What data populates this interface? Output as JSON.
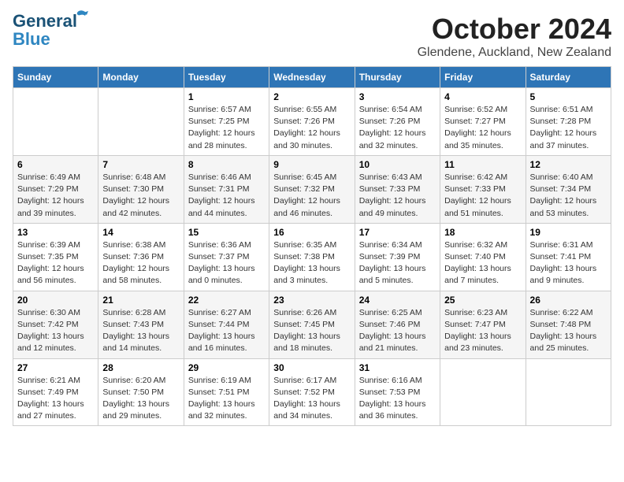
{
  "header": {
    "logo_general": "General",
    "logo_blue": "Blue",
    "month": "October 2024",
    "location": "Glendene, Auckland, New Zealand"
  },
  "weekdays": [
    "Sunday",
    "Monday",
    "Tuesday",
    "Wednesday",
    "Thursday",
    "Friday",
    "Saturday"
  ],
  "weeks": [
    [
      {
        "day": "",
        "info": ""
      },
      {
        "day": "",
        "info": ""
      },
      {
        "day": "1",
        "info": "Sunrise: 6:57 AM\nSunset: 7:25 PM\nDaylight: 12 hours\nand 28 minutes."
      },
      {
        "day": "2",
        "info": "Sunrise: 6:55 AM\nSunset: 7:26 PM\nDaylight: 12 hours\nand 30 minutes."
      },
      {
        "day": "3",
        "info": "Sunrise: 6:54 AM\nSunset: 7:26 PM\nDaylight: 12 hours\nand 32 minutes."
      },
      {
        "day": "4",
        "info": "Sunrise: 6:52 AM\nSunset: 7:27 PM\nDaylight: 12 hours\nand 35 minutes."
      },
      {
        "day": "5",
        "info": "Sunrise: 6:51 AM\nSunset: 7:28 PM\nDaylight: 12 hours\nand 37 minutes."
      }
    ],
    [
      {
        "day": "6",
        "info": "Sunrise: 6:49 AM\nSunset: 7:29 PM\nDaylight: 12 hours\nand 39 minutes."
      },
      {
        "day": "7",
        "info": "Sunrise: 6:48 AM\nSunset: 7:30 PM\nDaylight: 12 hours\nand 42 minutes."
      },
      {
        "day": "8",
        "info": "Sunrise: 6:46 AM\nSunset: 7:31 PM\nDaylight: 12 hours\nand 44 minutes."
      },
      {
        "day": "9",
        "info": "Sunrise: 6:45 AM\nSunset: 7:32 PM\nDaylight: 12 hours\nand 46 minutes."
      },
      {
        "day": "10",
        "info": "Sunrise: 6:43 AM\nSunset: 7:33 PM\nDaylight: 12 hours\nand 49 minutes."
      },
      {
        "day": "11",
        "info": "Sunrise: 6:42 AM\nSunset: 7:33 PM\nDaylight: 12 hours\nand 51 minutes."
      },
      {
        "day": "12",
        "info": "Sunrise: 6:40 AM\nSunset: 7:34 PM\nDaylight: 12 hours\nand 53 minutes."
      }
    ],
    [
      {
        "day": "13",
        "info": "Sunrise: 6:39 AM\nSunset: 7:35 PM\nDaylight: 12 hours\nand 56 minutes."
      },
      {
        "day": "14",
        "info": "Sunrise: 6:38 AM\nSunset: 7:36 PM\nDaylight: 12 hours\nand 58 minutes."
      },
      {
        "day": "15",
        "info": "Sunrise: 6:36 AM\nSunset: 7:37 PM\nDaylight: 13 hours\nand 0 minutes."
      },
      {
        "day": "16",
        "info": "Sunrise: 6:35 AM\nSunset: 7:38 PM\nDaylight: 13 hours\nand 3 minutes."
      },
      {
        "day": "17",
        "info": "Sunrise: 6:34 AM\nSunset: 7:39 PM\nDaylight: 13 hours\nand 5 minutes."
      },
      {
        "day": "18",
        "info": "Sunrise: 6:32 AM\nSunset: 7:40 PM\nDaylight: 13 hours\nand 7 minutes."
      },
      {
        "day": "19",
        "info": "Sunrise: 6:31 AM\nSunset: 7:41 PM\nDaylight: 13 hours\nand 9 minutes."
      }
    ],
    [
      {
        "day": "20",
        "info": "Sunrise: 6:30 AM\nSunset: 7:42 PM\nDaylight: 13 hours\nand 12 minutes."
      },
      {
        "day": "21",
        "info": "Sunrise: 6:28 AM\nSunset: 7:43 PM\nDaylight: 13 hours\nand 14 minutes."
      },
      {
        "day": "22",
        "info": "Sunrise: 6:27 AM\nSunset: 7:44 PM\nDaylight: 13 hours\nand 16 minutes."
      },
      {
        "day": "23",
        "info": "Sunrise: 6:26 AM\nSunset: 7:45 PM\nDaylight: 13 hours\nand 18 minutes."
      },
      {
        "day": "24",
        "info": "Sunrise: 6:25 AM\nSunset: 7:46 PM\nDaylight: 13 hours\nand 21 minutes."
      },
      {
        "day": "25",
        "info": "Sunrise: 6:23 AM\nSunset: 7:47 PM\nDaylight: 13 hours\nand 23 minutes."
      },
      {
        "day": "26",
        "info": "Sunrise: 6:22 AM\nSunset: 7:48 PM\nDaylight: 13 hours\nand 25 minutes."
      }
    ],
    [
      {
        "day": "27",
        "info": "Sunrise: 6:21 AM\nSunset: 7:49 PM\nDaylight: 13 hours\nand 27 minutes."
      },
      {
        "day": "28",
        "info": "Sunrise: 6:20 AM\nSunset: 7:50 PM\nDaylight: 13 hours\nand 29 minutes."
      },
      {
        "day": "29",
        "info": "Sunrise: 6:19 AM\nSunset: 7:51 PM\nDaylight: 13 hours\nand 32 minutes."
      },
      {
        "day": "30",
        "info": "Sunrise: 6:17 AM\nSunset: 7:52 PM\nDaylight: 13 hours\nand 34 minutes."
      },
      {
        "day": "31",
        "info": "Sunrise: 6:16 AM\nSunset: 7:53 PM\nDaylight: 13 hours\nand 36 minutes."
      },
      {
        "day": "",
        "info": ""
      },
      {
        "day": "",
        "info": ""
      }
    ]
  ]
}
